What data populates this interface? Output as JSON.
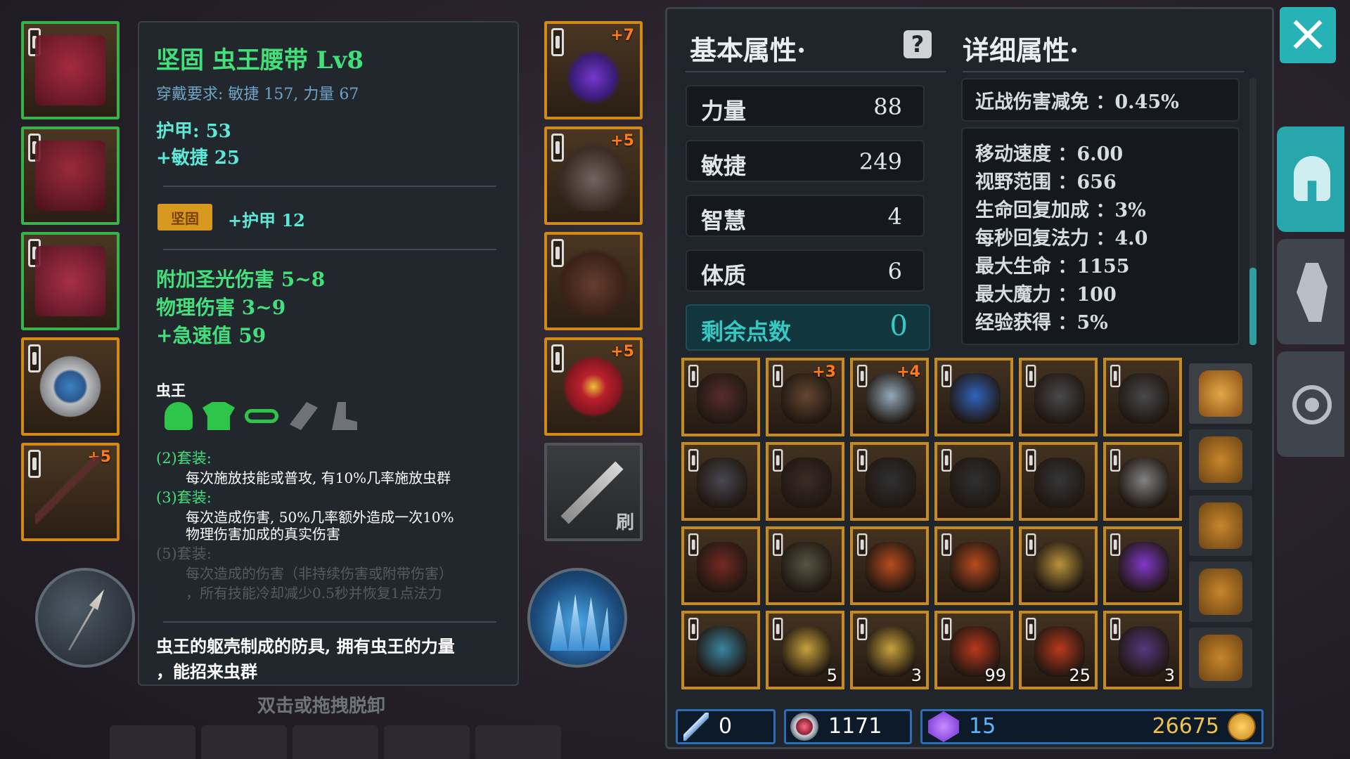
{
  "equip_left": [
    {
      "name": "helmet",
      "plus": ""
    },
    {
      "name": "chest",
      "plus": ""
    },
    {
      "name": "belt",
      "plus": ""
    },
    {
      "name": "ring",
      "plus": ""
    },
    {
      "name": "bow",
      "plus": "+5"
    }
  ],
  "equip_right": [
    {
      "name": "amulet",
      "plus": "+7"
    },
    {
      "name": "gloves",
      "plus": "+5"
    },
    {
      "name": "boots",
      "plus": ""
    },
    {
      "name": "red-ring",
      "plus": "+5"
    }
  ],
  "skill_slot_label": "刷",
  "tooltip": {
    "title": "坚固 虫王腰带 Lv8",
    "requirement": "穿戴要求:  敏捷 157, 力量 67",
    "armor": "护甲:  53",
    "agility": "+敏捷 25",
    "badge": "坚固",
    "badge_bonus": "+护甲 12",
    "affix1": "附加圣光伤害 5~8",
    "affix2": "物理伤害 3~9",
    "affix3": "+急速值 59",
    "set_name": "虫王",
    "set2_label": "(2)套装:",
    "set2_desc": "每次施放技能或普攻, 有10%几率施放虫群",
    "set3_label": "(3)套装:",
    "set3_desc1": "每次造成伤害, 50%几率额外造成一次10%",
    "set3_desc2": "物理伤害加成的真实伤害",
    "set5_label": "(5)套装:",
    "set5_desc1": "每次造成的伤害（非持续伤害或附带伤害）",
    "set5_desc2": "，所有技能冷却减少0.5秒并恢复1点法力",
    "flavor1": "虫王的躯壳制成的防具, 拥有虫王的力量",
    "flavor2": "，能招来虫群",
    "hint": "双击或拖拽脱卸"
  },
  "panel": {
    "basic_header": "基本属性·",
    "detail_header": "详细属性·",
    "stats": [
      {
        "label": "力量",
        "value": "88"
      },
      {
        "label": "敏捷",
        "value": "249"
      },
      {
        "label": "智慧",
        "value": "4"
      },
      {
        "label": "体质",
        "value": "6"
      }
    ],
    "remaining_label": "剩余点数",
    "remaining_value": "0",
    "melee_reduction": "近战伤害减免 ：0.45%",
    "details": [
      "移动速度 ：6.00",
      "视野范围 ：656",
      "生命回复加成 ：3%",
      "每秒回复法力 ：4.0",
      "最大生命 ：1155",
      "最大魔力 ：100",
      "经验获得 ：5%"
    ]
  },
  "inventory": [
    [
      {
        "n": "bow",
        "p": "",
        "c": ""
      },
      {
        "n": "armor",
        "p": "+3",
        "c": ""
      },
      {
        "n": "blue-ring",
        "p": "+4",
        "c": ""
      },
      {
        "n": "crystal-armor",
        "p": "",
        "c": ""
      },
      {
        "n": "dark-ring",
        "p": "",
        "c": ""
      },
      {
        "n": "dark-ring",
        "p": "",
        "c": ""
      }
    ],
    [
      {
        "n": "helmet",
        "p": "",
        "c": ""
      },
      {
        "n": "gloves",
        "p": "",
        "c": ""
      },
      {
        "n": "dark-armor",
        "p": "",
        "c": ""
      },
      {
        "n": "dark-armor",
        "p": "",
        "c": ""
      },
      {
        "n": "gauntlet",
        "p": "",
        "c": ""
      },
      {
        "n": "knight-helmet",
        "p": "",
        "c": ""
      }
    ],
    [
      {
        "n": "red-armor",
        "p": "",
        "c": ""
      },
      {
        "n": "bracer",
        "p": "",
        "c": ""
      },
      {
        "n": "amulet",
        "p": "",
        "c": ""
      },
      {
        "n": "amulet",
        "p": "",
        "c": ""
      },
      {
        "n": "gold-ring",
        "p": "",
        "c": ""
      },
      {
        "n": "purple-gem",
        "p": "",
        "c": ""
      }
    ],
    [
      {
        "n": "blue-scroll",
        "p": "",
        "c": ""
      },
      {
        "n": "scroll",
        "p": "",
        "c": "5"
      },
      {
        "n": "scroll",
        "p": "",
        "c": "3"
      },
      {
        "n": "red-orb",
        "p": "",
        "c": "99"
      },
      {
        "n": "red-orb",
        "p": "",
        "c": "25"
      },
      {
        "n": "purple-shard",
        "p": "",
        "c": "3"
      }
    ]
  ],
  "currency": {
    "wand": "0",
    "crystal": "1171",
    "gem": "15",
    "gold": "26675"
  },
  "colors": {
    "accent_green": "#42e07a",
    "accent_teal": "#5fe7d8",
    "slot_gold": "#d28a17",
    "close_teal": "#27b3b6"
  }
}
